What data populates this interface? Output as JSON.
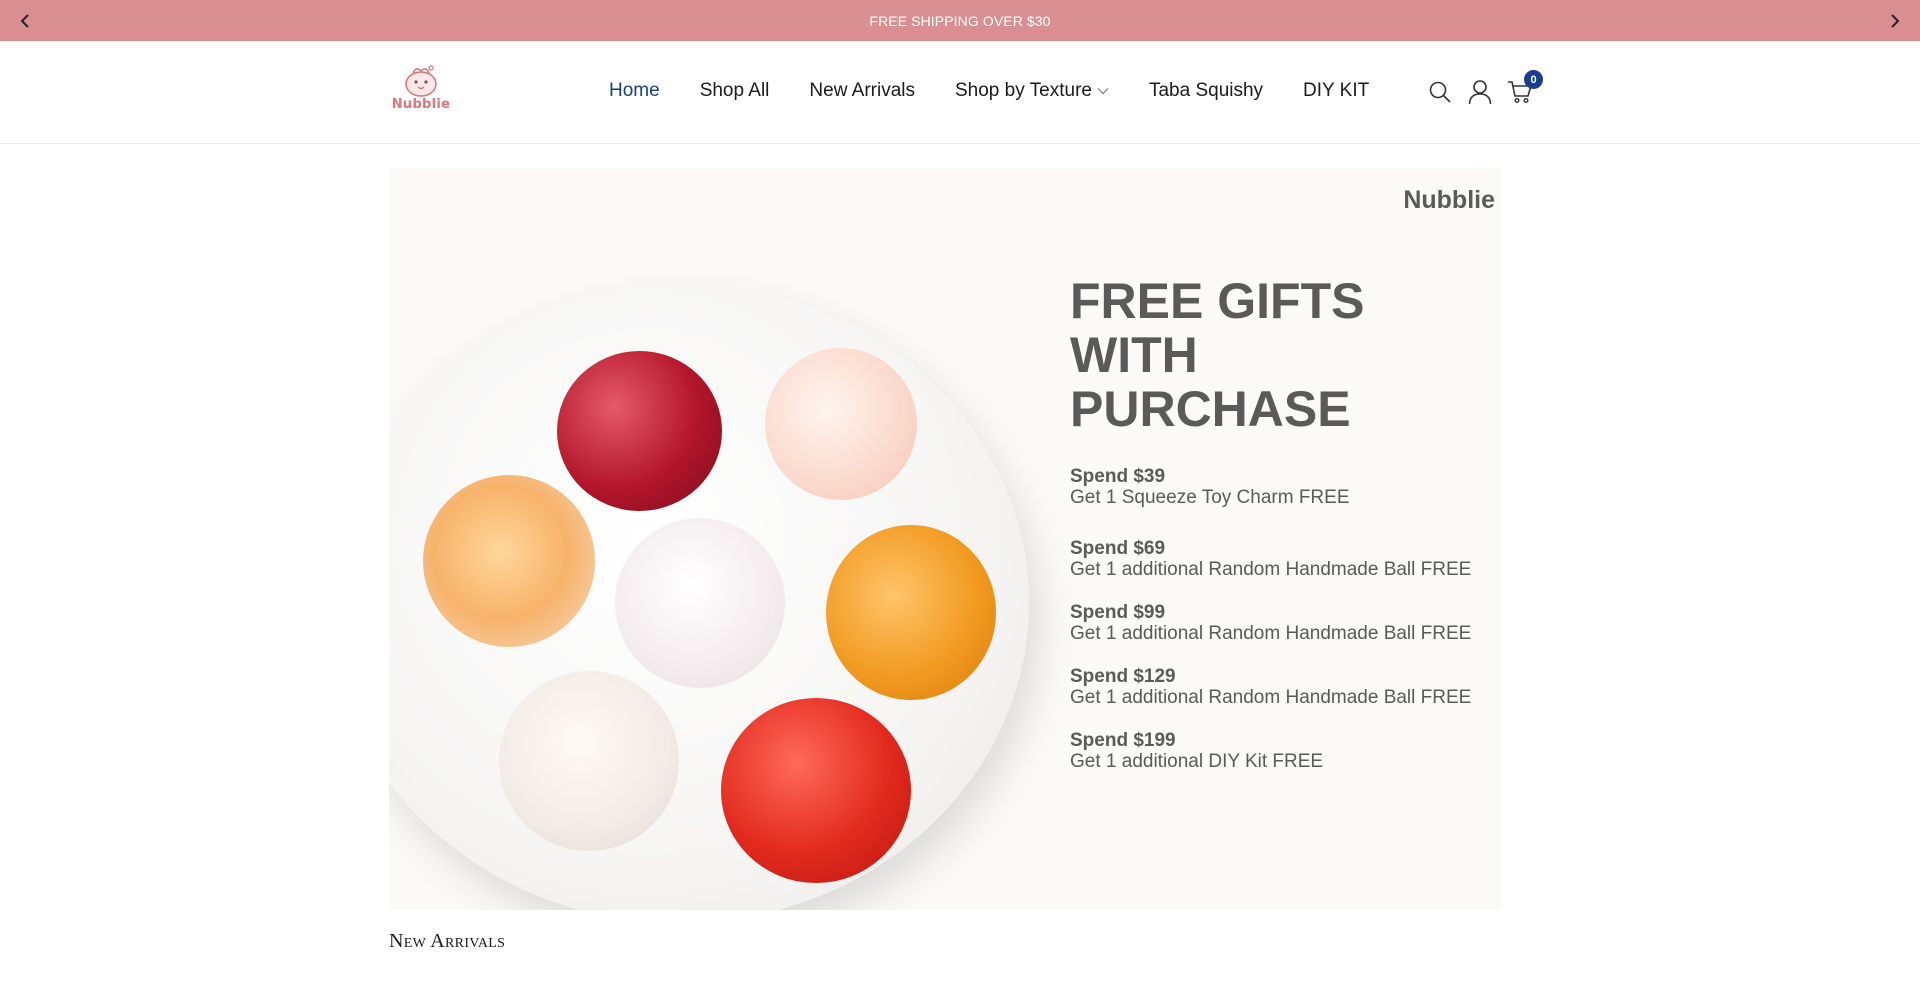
{
  "announcement": {
    "text": "FREE SHIPPING OVER $30",
    "background": "#d98f92"
  },
  "header": {
    "logo_text": "Nubblie",
    "nav": [
      {
        "label": "Home",
        "active": true
      },
      {
        "label": "Shop All"
      },
      {
        "label": "New Arrivals"
      },
      {
        "label": "Shop by Texture",
        "has_dropdown": true
      },
      {
        "label": "Taba Squishy"
      },
      {
        "label": "DIY KIT"
      }
    ],
    "icons": [
      "search-icon",
      "account-icon",
      "cart-icon"
    ],
    "cart_count": "0",
    "accent": "#1a3d8f"
  },
  "hero": {
    "brand": "Nubblie",
    "title_lines": [
      "FREE GIFTS",
      "WITH",
      "PURCHASE"
    ],
    "tiers": [
      {
        "spend": "Spend $39",
        "reward": "Get 1 Squeeze Toy Charm FREE"
      },
      {
        "spend": "Spend $69",
        "reward": "Get 1 additional Random Handmade Ball FREE"
      },
      {
        "spend": "Spend $99",
        "reward": "Get 1 additional Random Handmade Ball FREE"
      },
      {
        "spend": "Spend $129",
        "reward": "Get 1 additional Random Handmade Ball FREE"
      },
      {
        "spend": "Spend $199",
        "reward": "Get 1 additional DIY Kit FREE"
      }
    ]
  },
  "sections": {
    "new_arrivals_title": "New Arrivals"
  }
}
